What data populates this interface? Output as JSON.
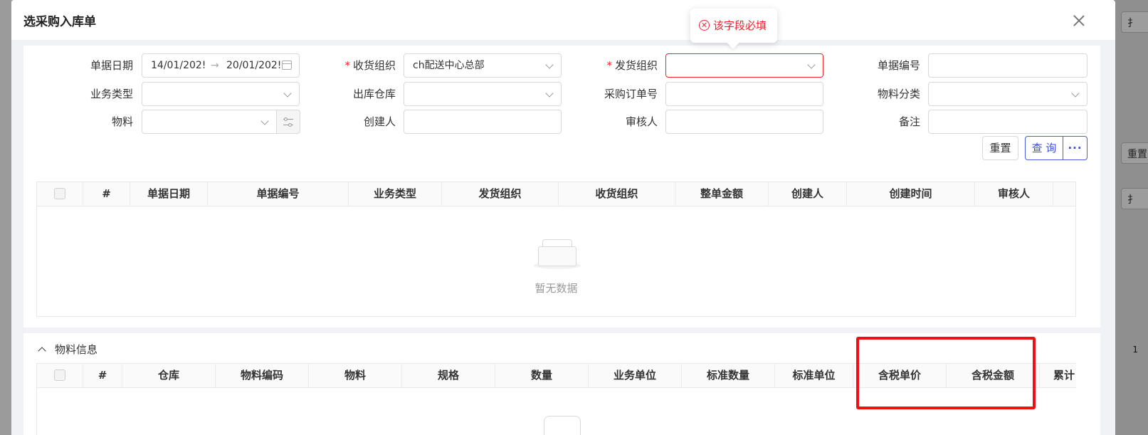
{
  "modal": {
    "title": "选采购入库单"
  },
  "filters": {
    "bill_date_label": "单据日期",
    "bill_date_start": "14/01/202!",
    "bill_date_end": "20/01/202!",
    "receive_org_label": "收货组织",
    "receive_org_value": "ch配送中心总部",
    "ship_org_label": "发货组织",
    "ship_org_value": "",
    "bill_no_label": "单据编号",
    "biz_type_label": "业务类型",
    "out_warehouse_label": "出库仓库",
    "po_no_label": "采购订单号",
    "material_category_label": "物料分类",
    "material_label": "物料",
    "creator_label": "创建人",
    "auditor_label": "审核人",
    "remark_label": "备注",
    "required_mark": "*",
    "range_arrow": "→"
  },
  "validation": {
    "message": "该字段必填"
  },
  "buttons": {
    "reset": "重置",
    "query": "查 询",
    "more": "···"
  },
  "bills_table": {
    "columns": [
      "#",
      "单据日期",
      "单据编号",
      "业务类型",
      "发货组织",
      "收货组织",
      "整单金额",
      "创建人",
      "创建时间",
      "审核人"
    ],
    "empty_text": "暂无数据"
  },
  "material_section": {
    "title": "物料信息",
    "columns": [
      "#",
      "仓库",
      "物料编码",
      "物料",
      "规格",
      "数量",
      "业务单位",
      "标准数量",
      "标准单位",
      "含税单价",
      "含税金额",
      "累计"
    ]
  },
  "background": {
    "btn_top": "扌",
    "btn_mid": "重置",
    "btn_low": "扌",
    "page_num": "1"
  },
  "colors": {
    "primary": "#3b4ce0",
    "error": "#f5222d",
    "highlight": "#ee1111"
  }
}
